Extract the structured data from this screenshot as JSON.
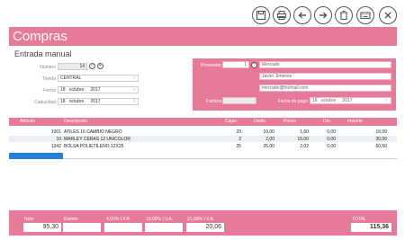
{
  "toolbar": {
    "icons": [
      "save-icon",
      "print-icon",
      "back-icon",
      "forward-icon",
      "delete-icon",
      "keyboard-icon",
      "close-icon"
    ]
  },
  "header": {
    "title": "Compras"
  },
  "entrada": {
    "title": "Entrada manual",
    "numero_label": "Número",
    "numero_value": "14",
    "tienda_label": "Tienda",
    "tienda_value": "CENTRAL",
    "fecha_label": "Fecha",
    "fecha_day": "18",
    "fecha_month": "octubre",
    "fecha_year": "2017",
    "caducidad_label": "Caducidad",
    "caducidad_day": "18",
    "caducidad_month": "octubre",
    "caducidad_year": "2017"
  },
  "proveedor": {
    "label": "Proveedor",
    "number": "1",
    "name": "Mercado",
    "contact": "Javier Jiménez",
    "email": "mercado@hotmail.com",
    "factura_label": "Factura",
    "factura_value": "",
    "fecha_pago_label": "Fecha de pago",
    "fecha_pago_day": "18",
    "fecha_pago_month": "octubre",
    "fecha_pago_year": "2017"
  },
  "table": {
    "headers": [
      "Artículo",
      "Descripción",
      "Cajas",
      "Unids.",
      "Precio",
      "Dto.",
      "Importe"
    ],
    "rows": [
      {
        "articulo": "1001",
        "descripcion": "ATILES 16 CAMBIO NEGRO",
        "cajas": "20",
        "unids": "10,00",
        "precio": "1,60",
        "dto": "0,00",
        "importe": "16,00"
      },
      {
        "articulo": "10",
        "descripcion": "MARLEY CERAS 12 UNICOLOR",
        "cajas": "2",
        "unids": "2,00",
        "precio": "15,00",
        "dto": "0,00",
        "importe": "30,00"
      },
      {
        "articulo": "1342",
        "descripcion": "BOLSA POLIETILENO 12X25",
        "cajas": "25",
        "unids": "25,00",
        "precio": "2,02",
        "dto": "0,00",
        "importe": "50,50"
      }
    ]
  },
  "footer": {
    "neto_label": "Neto",
    "neto_value": "95,30",
    "exento_label": "Exento",
    "exento_value": "",
    "iva4_label": "4,00% I.V.A.",
    "iva4_value": "",
    "iva10_label": "10,00% I.V.A.",
    "iva10_value": "",
    "iva21_label": "21,00% I.V.A.",
    "iva21_value": "20,06",
    "total_label": "TOTAL",
    "total_value": "115,36"
  },
  "colors": {
    "accent": "#e57b99",
    "selection": "#2680d9"
  }
}
